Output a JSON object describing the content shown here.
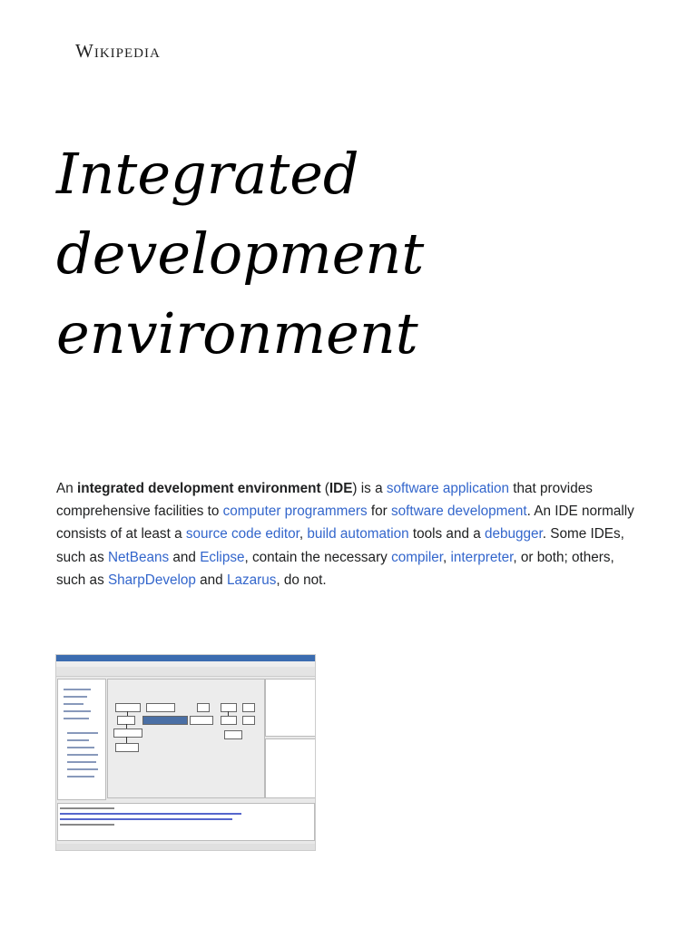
{
  "header": {
    "logo": "Wikipedia"
  },
  "article": {
    "title_lines": [
      "Integrated",
      "development",
      "environment"
    ],
    "intro": {
      "t1": "An ",
      "b1": "integrated development environment",
      "t2": " (",
      "b2": "IDE",
      "t3": ") is a ",
      "l1": "software application",
      "t4": " that provides comprehensive facilities to ",
      "l2": "computer programmers",
      "t5": " for ",
      "l3": "software development",
      "t6": ". An IDE normally consists of at least a ",
      "l4": "source code editor",
      "t7": ", ",
      "l5": "build automation",
      "t8": " tools and a ",
      "l6": "debugger",
      "t9": ". Some IDEs, such as ",
      "l7": "NetBeans",
      "t10": " and ",
      "l8": "Eclipse",
      "t11": ", contain the necessary ",
      "l9": "compiler",
      "t12": ", ",
      "l10": "interpreter",
      "t13": ", or both; others, such as ",
      "l11": "SharpDevelop",
      "t14": " and ",
      "l12": "Lazarus",
      "t15": ", do not."
    }
  },
  "colors": {
    "link": "#3366cc",
    "text": "#202122"
  }
}
